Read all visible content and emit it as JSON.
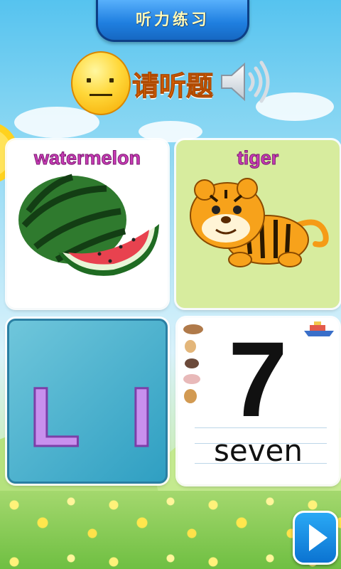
{
  "screen": {
    "title": "听力练习"
  },
  "header": {
    "prompt": "请听题"
  },
  "cards": [
    {
      "label": "watermelon",
      "image": "watermelon-slice"
    },
    {
      "label": "tiger",
      "image": "cartoon-tiger"
    },
    {
      "letters": [
        "L",
        "I"
      ]
    },
    {
      "digit": "7",
      "word": "seven"
    }
  ],
  "icons": {
    "face": "neutral-face-icon",
    "speaker": "speaker-icon",
    "next": "play-next-icon"
  },
  "colors": {
    "title_bar": "#1f7fe0",
    "prompt_text": "#ff7a00",
    "card_label": "#c93ab6",
    "letter_fill": "#c890ee",
    "play_button": "#0b73d1"
  }
}
